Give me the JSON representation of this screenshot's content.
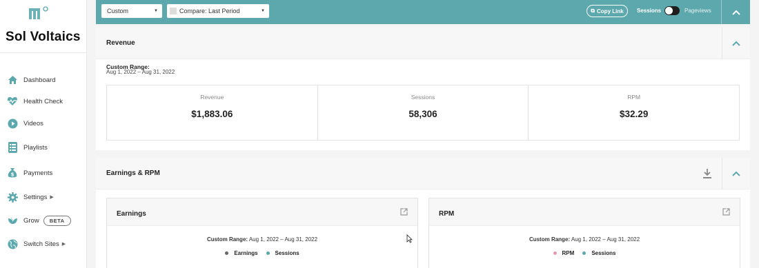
{
  "sidebar": {
    "site_name": "Sol Voltaics",
    "items": [
      {
        "label": "Dashboard",
        "icon": "home-icon"
      },
      {
        "label": "Health Check",
        "icon": "heartbeat-icon"
      },
      {
        "label": "Videos",
        "icon": "play-icon"
      },
      {
        "label": "Playlists",
        "icon": "list-icon"
      },
      {
        "label": "Payments",
        "icon": "money-bag-icon"
      },
      {
        "label": "Settings",
        "icon": "gear-icon"
      },
      {
        "label": "Grow",
        "icon": "leaf-icon",
        "badge": "BETA"
      },
      {
        "label": "Switch Sites",
        "icon": "globe-icon"
      }
    ]
  },
  "topbar": {
    "date_select": "Custom",
    "compare_select": "Compare: Last Period",
    "copy_link": "Copy Link",
    "toggle_left": "Sessions",
    "toggle_right": "Pageviews",
    "accent_color": "#5ca8ad"
  },
  "revenue_panel": {
    "title": "Revenue",
    "range_label": "Custom Range:",
    "range_value": "Aug 1, 2022 – Aug 31, 2022",
    "stats": [
      {
        "label": "Revenue",
        "value": "$1,883.06"
      },
      {
        "label": "Sessions",
        "value": "58,306"
      },
      {
        "label": "RPM",
        "value": "$32.29"
      }
    ]
  },
  "earnings_panel": {
    "title": "Earnings & RPM",
    "cards": [
      {
        "title": "Earnings",
        "range_label": "Custom Range:",
        "range_value": "Aug 1, 2022 – Aug 31, 2022",
        "legend": [
          {
            "label": "Earnings",
            "color": "#666666"
          },
          {
            "label": "Sessions",
            "color": "#5ca8ad"
          }
        ]
      },
      {
        "title": "RPM",
        "range_label": "Custom Range:",
        "range_value": "Aug 1, 2022 – Aug 31, 2022",
        "legend": [
          {
            "label": "RPM",
            "color": "#e39ab0"
          },
          {
            "label": "Sessions",
            "color": "#5ca8ad"
          }
        ]
      }
    ]
  }
}
